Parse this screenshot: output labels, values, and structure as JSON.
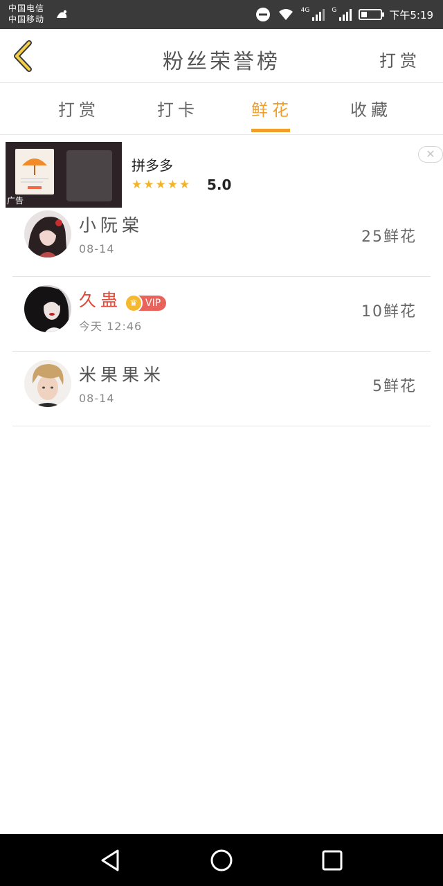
{
  "status_bar": {
    "carrier_1": "中国电信",
    "carrier_2": "中国移动",
    "network_1": "4G",
    "network_2": "G",
    "time": "下午5:19",
    "icons": [
      "notification-icon",
      "dnd-icon",
      "wifi-icon",
      "signal-icon",
      "battery-icon"
    ]
  },
  "header": {
    "title": "粉丝荣誉榜",
    "action_label": "打赏"
  },
  "tabs": [
    {
      "label": "打赏",
      "active": false
    },
    {
      "label": "打卡",
      "active": false
    },
    {
      "label": "鲜花",
      "active": true
    },
    {
      "label": "收藏",
      "active": false
    }
  ],
  "ad": {
    "tag": "广告",
    "title": "拼多多",
    "stars": "★★★★★",
    "score": "5.0",
    "close_symbol": "✕"
  },
  "fans": [
    {
      "name": "小阮棠",
      "time": "08-14",
      "count": "25鲜花",
      "vip": false
    },
    {
      "name": "久蛊",
      "time": "今天 12:46",
      "count": "10鲜花",
      "vip": true,
      "vip_label": "VIP"
    },
    {
      "name": "米果果米",
      "time": "08-14",
      "count": "5鲜花",
      "vip": false
    }
  ],
  "colors": {
    "accent": "#f0a02a",
    "vip_name": "#e04a3a",
    "vip_badge": "#e9635d"
  }
}
